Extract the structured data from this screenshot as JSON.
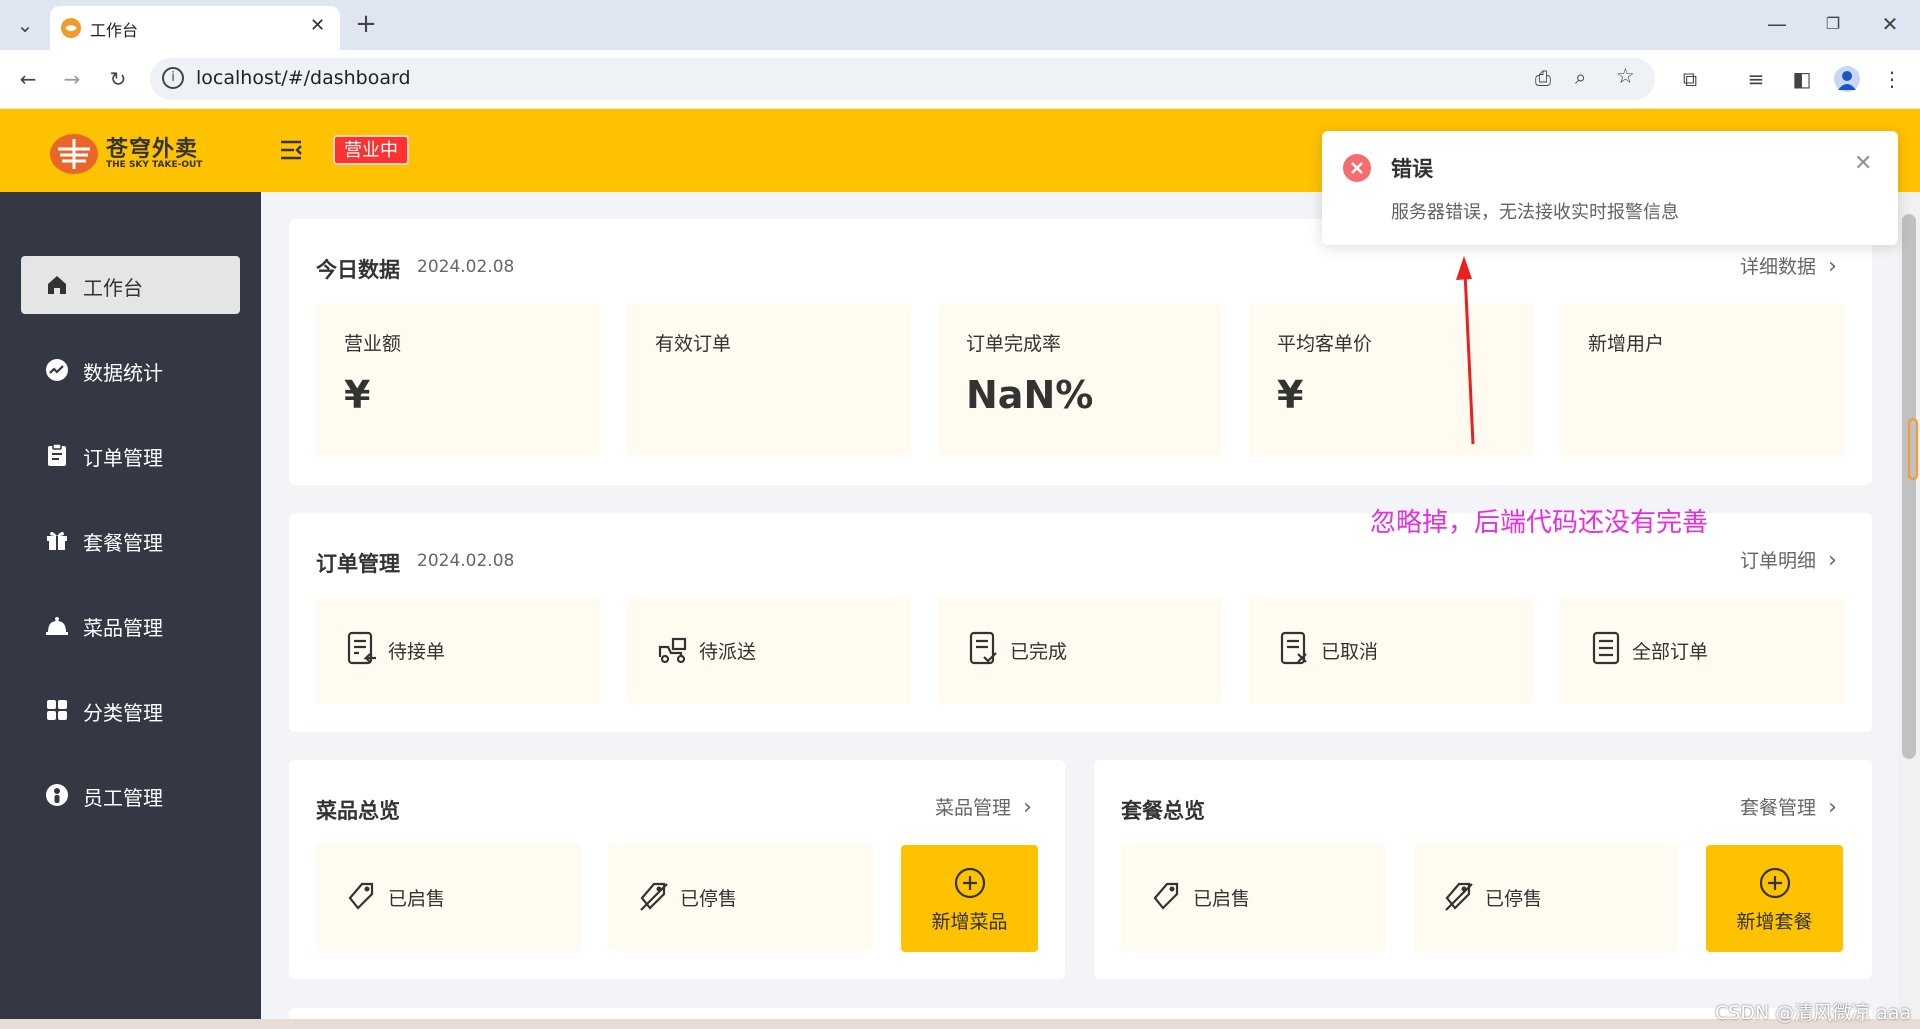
{
  "browser": {
    "tab_title": "工作台",
    "url": "localhost/#/dashboard"
  },
  "header": {
    "logo_text": "苍穹外卖",
    "logo_subtext": "THE SKY TAKE-OUT",
    "status": "营业中"
  },
  "sidebar": {
    "items": [
      {
        "label": "工作台",
        "icon": "home-icon"
      },
      {
        "label": "数据统计",
        "icon": "chart-icon"
      },
      {
        "label": "订单管理",
        "icon": "clipboard-icon"
      },
      {
        "label": "套餐管理",
        "icon": "gift-icon"
      },
      {
        "label": "菜品管理",
        "icon": "dish-icon"
      },
      {
        "label": "分类管理",
        "icon": "grid-icon"
      },
      {
        "label": "员工管理",
        "icon": "person-icon"
      }
    ]
  },
  "today": {
    "title": "今日数据",
    "date": "2024.02.08",
    "link": "详细数据",
    "tiles": [
      {
        "label": "营业额",
        "value": "¥"
      },
      {
        "label": "有效订单",
        "value": ""
      },
      {
        "label": "订单完成率",
        "value": "NaN%"
      },
      {
        "label": "平均客单价",
        "value": "¥"
      },
      {
        "label": "新增用户",
        "value": ""
      }
    ]
  },
  "orders": {
    "title": "订单管理",
    "date": "2024.02.08",
    "link": "订单明细",
    "tiles": [
      {
        "label": "待接单",
        "icon": "order-pending-icon"
      },
      {
        "label": "待派送",
        "icon": "delivery-icon"
      },
      {
        "label": "已完成",
        "icon": "order-done-icon"
      },
      {
        "label": "已取消",
        "icon": "order-cancel-icon"
      },
      {
        "label": "全部订单",
        "icon": "order-all-icon"
      }
    ]
  },
  "dishes": {
    "title": "菜品总览",
    "link": "菜品管理",
    "on_sale": "已启售",
    "off_sale": "已停售",
    "add_label": "新增菜品"
  },
  "setmeals": {
    "title": "套餐总览",
    "link": "套餐管理",
    "on_sale": "已启售",
    "off_sale": "已停售",
    "add_label": "新增套餐"
  },
  "toast": {
    "title": "错误",
    "message": "服务器错误，无法接收实时报警信息"
  },
  "annotation": "忽略掉，后端代码还没有完善",
  "watermark": "CSDN @清风微凉 aaa",
  "colors": {
    "header": "#ffc200",
    "sidebar": "#343744",
    "tile": "#fffbf0",
    "status_tag": "#fd3333",
    "annotation": "#e82ee0",
    "error": "#f56c6c"
  }
}
